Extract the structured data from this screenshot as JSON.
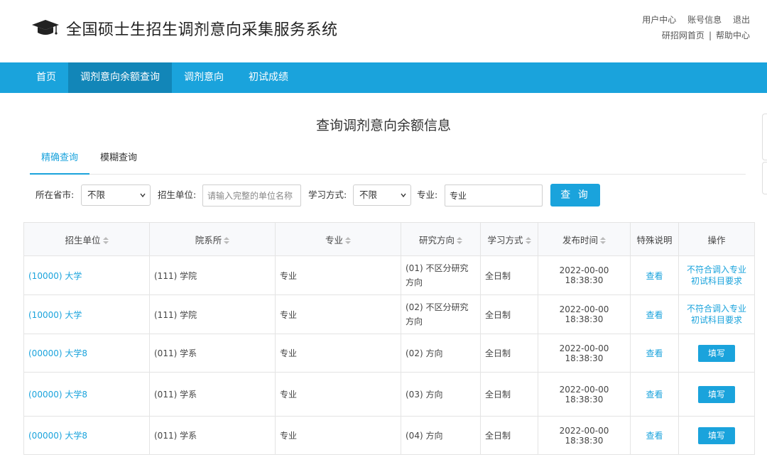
{
  "header": {
    "title": "全国硕士生招生调剂意向采集服务系统",
    "links_row1": [
      "用户中心",
      "账号信息",
      "退出"
    ],
    "links_row2": [
      "研招网首页",
      "帮助中心"
    ],
    "separator": "|"
  },
  "nav": {
    "items": [
      {
        "label": "首页",
        "active": false
      },
      {
        "label": "调剂意向余额查询",
        "active": true
      },
      {
        "label": "调剂意向",
        "active": false
      },
      {
        "label": "初试成绩",
        "active": false
      }
    ]
  },
  "page": {
    "heading": "查询调剂意向余额信息",
    "tabs": [
      {
        "label": "精确查询",
        "active": true
      },
      {
        "label": "模糊查询",
        "active": false
      }
    ]
  },
  "filters": {
    "province_label": "所在省市:",
    "province_value": "不限",
    "unit_label": "招生单位:",
    "unit_placeholder": "请输入完整的单位名称",
    "mode_label": "学习方式:",
    "mode_value": "不限",
    "major_label": "专业:",
    "major_value": "专业",
    "query_button": "查 询"
  },
  "table": {
    "columns": [
      "招生单位",
      "院系所",
      "专业",
      "研究方向",
      "学习方式",
      "发布时间",
      "特殊说明",
      "操作"
    ],
    "rows": [
      {
        "unit": "(10000) 大学",
        "dept": "(111) 学院",
        "major": "专业",
        "direction": "(01) 不区分研究方向",
        "mode": "全日制",
        "time": "2022-00-00 18:38:30",
        "note": "查看",
        "action": "不符合调入专业初试科目要求",
        "action_type": "text"
      },
      {
        "unit": "(10000) 大学",
        "dept": "(111) 学院",
        "major": "专业",
        "direction": "(02) 不区分研究方向",
        "mode": "全日制",
        "time": "2022-00-00 18:38:30",
        "note": "查看",
        "action": "不符合调入专业初试科目要求",
        "action_type": "text"
      },
      {
        "unit": "(00000) 大学8",
        "dept": "(011) 学系",
        "major": "专业",
        "direction": "(02) 方向",
        "mode": "全日制",
        "time": "2022-00-00 18:38:30",
        "note": "查看",
        "action": "填写",
        "action_type": "button"
      },
      {
        "unit": "(00000) 大学8",
        "dept": "(011) 学系",
        "major": "专业",
        "direction": "(03) 方向",
        "mode": "全日制",
        "time": "2022-00-00 18:38:30",
        "note": "查看",
        "action": "填写",
        "action_type": "button"
      },
      {
        "unit": "(00000) 大学8",
        "dept": "(011) 学系",
        "major": "专业",
        "direction": "(04) 方向",
        "mode": "全日制",
        "time": "2022-00-00 18:38:30",
        "note": "查看",
        "action": "填写",
        "action_type": "button"
      }
    ]
  },
  "colors": {
    "primary": "#1aa3dc",
    "nav_active": "#1286b8"
  }
}
